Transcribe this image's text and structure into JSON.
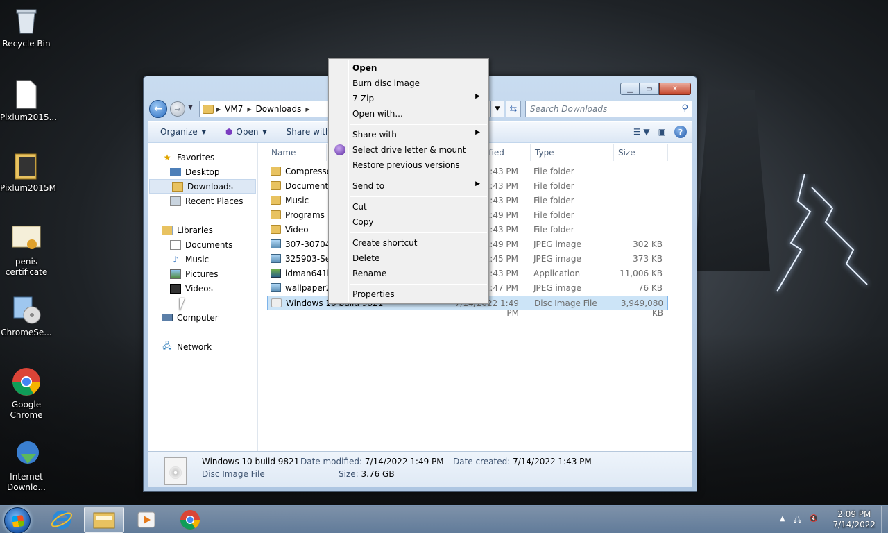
{
  "desktop": {
    "icons": [
      {
        "label": "Recycle Bin",
        "icon": "recycle-bin-icon"
      },
      {
        "label": "Pixlum2015...",
        "icon": "file-icon"
      },
      {
        "label": "Pixlum2015M",
        "icon": "folder-icon"
      },
      {
        "label": "penis certificate",
        "icon": "certificate-icon"
      },
      {
        "label": "ChromeSe...",
        "icon": "installer-icon"
      },
      {
        "label": "Google Chrome",
        "icon": "chrome-icon"
      },
      {
        "label": "Internet Downlo...",
        "icon": "idm-icon"
      }
    ]
  },
  "explorer": {
    "breadcrumb": [
      "VM7",
      "Downloads"
    ],
    "search_placeholder": "Search Downloads",
    "toolbar": {
      "organize": "Organize",
      "open": "Open",
      "share_with": "Share with"
    },
    "nav_pane": {
      "favorites": "Favorites",
      "desktop": "Desktop",
      "downloads": "Downloads",
      "recent_places": "Recent Places",
      "libraries": "Libraries",
      "documents": "Documents",
      "music": "Music",
      "pictures": "Pictures",
      "videos": "Videos",
      "computer": "Computer",
      "network": "Network"
    },
    "columns": {
      "name": "Name",
      "date": "ified",
      "type": "Type",
      "size": "Size"
    },
    "files": [
      {
        "name": "Compresse",
        "date": "1:43 PM",
        "type": "File folder",
        "size": "",
        "kind": "folder"
      },
      {
        "name": "Documents",
        "date": "1:43 PM",
        "type": "File folder",
        "size": "",
        "kind": "folder"
      },
      {
        "name": "Music",
        "date": "1:43 PM",
        "type": "File folder",
        "size": "",
        "kind": "folder"
      },
      {
        "name": "Programs",
        "date": "1:49 PM",
        "type": "File folder",
        "size": "",
        "kind": "folder"
      },
      {
        "name": "Video",
        "date": "1:43 PM",
        "type": "File folder",
        "size": "",
        "kind": "folder"
      },
      {
        "name": "307-307040",
        "date": "1:49 PM",
        "type": "JPEG image",
        "size": "302 KB",
        "kind": "img"
      },
      {
        "name": "325903-Sep",
        "date": "1:45 PM",
        "type": "JPEG image",
        "size": "373 KB",
        "kind": "img"
      },
      {
        "name": "idman641b",
        "date": "1:43 PM",
        "type": "Application",
        "size": "11,006 KB",
        "kind": "app"
      },
      {
        "name": "wallpaper2y",
        "date": "1:47 PM",
        "type": "JPEG image",
        "size": "76 KB",
        "kind": "img"
      },
      {
        "name": "Windows 10 build 9821",
        "date": "7/14/2022 1:49 PM",
        "type": "Disc Image File",
        "size": "3,949,080 KB",
        "kind": "disc"
      }
    ],
    "details": {
      "name": "Windows 10 build 9821",
      "type": "Disc Image File",
      "modified_label": "Date modified:",
      "modified": "7/14/2022 1:49 PM",
      "created_label": "Date created:",
      "created": "7/14/2022 1:43 PM",
      "size_label": "Size:",
      "size": "3.76 GB"
    }
  },
  "context_menu": {
    "open": "Open",
    "burn": "Burn disc image",
    "zip": "7-Zip",
    "open_with": "Open with...",
    "share_with": "Share with",
    "select_drive": "Select drive letter & mount",
    "restore": "Restore previous versions",
    "send_to": "Send to",
    "cut": "Cut",
    "copy": "Copy",
    "create_shortcut": "Create shortcut",
    "delete": "Delete",
    "rename": "Rename",
    "properties": "Properties"
  },
  "taskbar": {
    "time": "2:09 PM",
    "date": "7/14/2022"
  }
}
